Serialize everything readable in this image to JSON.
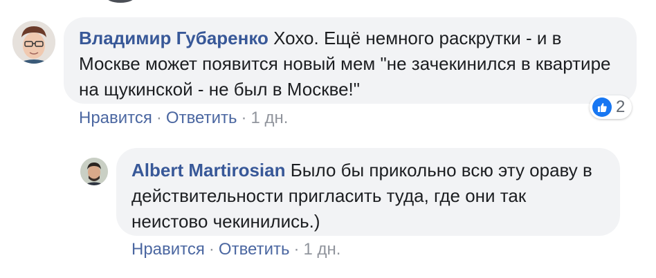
{
  "comments": [
    {
      "author": "Владимир Губаренко",
      "text": "Хохо. Ещё немного раскрутки - и в Москве может появится новый мем \"не зачекинился в квартире на щукинской - не был в Москве!\"",
      "like_label": "Нравится",
      "reply_label": "Ответить",
      "time": "1 дн.",
      "reactions": {
        "icon": "like-icon",
        "count": "2"
      }
    },
    {
      "author": "Albert Martirosian",
      "text": "Было бы прикольно всю эту ораву в действительности пригласить туда, где они так неистово чекинились.)",
      "like_label": "Нравится",
      "reply_label": "Ответить",
      "time": "1 дн."
    }
  ],
  "separator": "·",
  "colors": {
    "author": "#385898",
    "bubble": "#f2f3f5",
    "meta": "#90949c",
    "like": "#1877f2"
  }
}
